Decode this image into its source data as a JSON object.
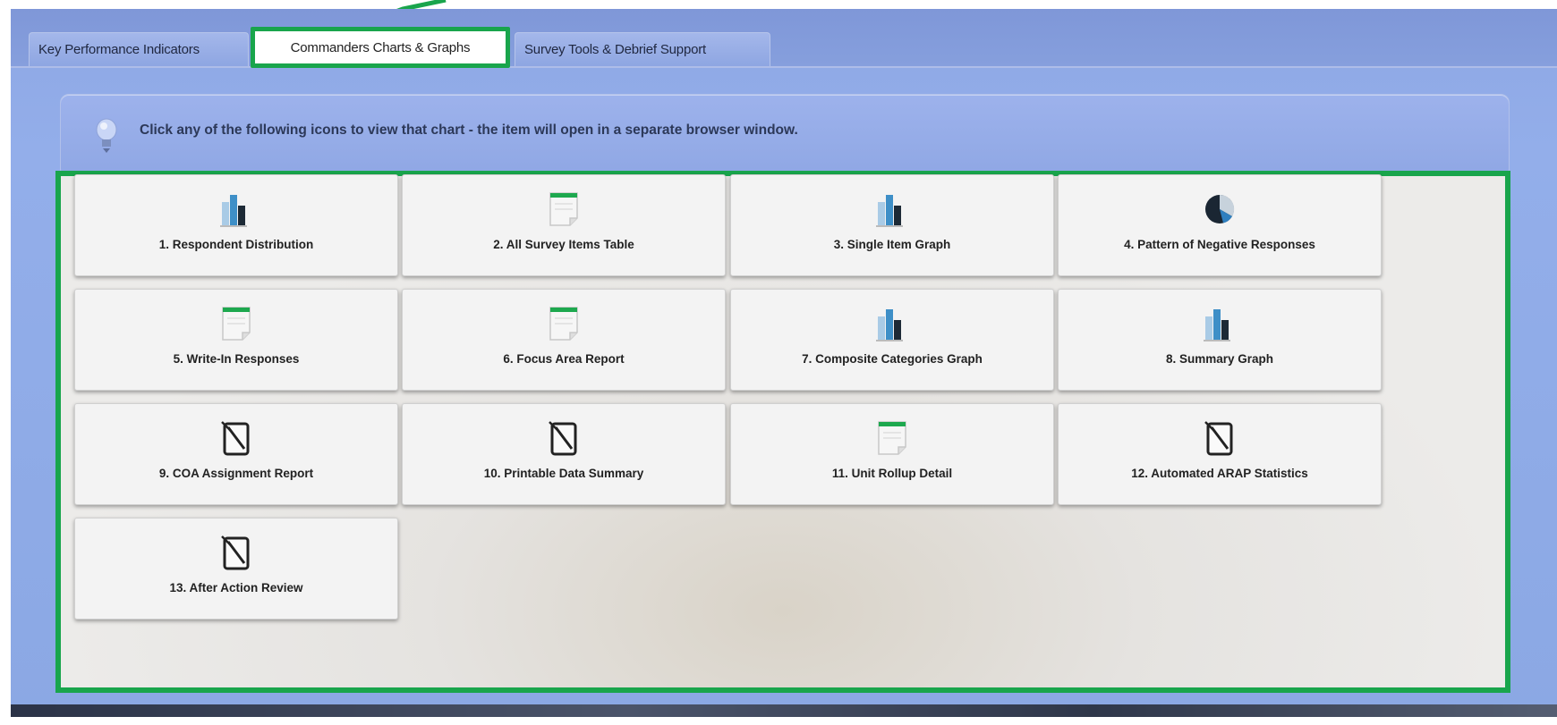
{
  "tabs": [
    {
      "label": "Key Performance Indicators"
    },
    {
      "label": "Commanders Charts & Graphs"
    },
    {
      "label": "Survey Tools & Debrief Support"
    }
  ],
  "info": {
    "message": "Click any of the following icons to view that chart - the item will open in a separate browser window.",
    "icon": "lightbulb-icon"
  },
  "cards": [
    {
      "label": "1. Respondent Distribution",
      "icon": "bar-chart-icon"
    },
    {
      "label": "2. All Survey Items Table",
      "icon": "document-icon"
    },
    {
      "label": "3. Single Item Graph",
      "icon": "bar-chart-icon"
    },
    {
      "label": "4. Pattern of Negative Responses",
      "icon": "pie-chart-icon"
    },
    {
      "label": "5. Write-In Responses",
      "icon": "document-icon"
    },
    {
      "label": "6. Focus Area Report",
      "icon": "document-icon"
    },
    {
      "label": "7. Composite Categories Graph",
      "icon": "bar-chart-icon"
    },
    {
      "label": "8. Summary Graph",
      "icon": "bar-chart-icon"
    },
    {
      "label": "9. COA Assignment Report",
      "icon": "edit-document-icon"
    },
    {
      "label": "10. Printable Data Summary",
      "icon": "edit-document-icon"
    },
    {
      "label": "11. Unit Rollup Detail",
      "icon": "document-icon"
    },
    {
      "label": "12. Automated ARAP Statistics",
      "icon": "edit-document-icon"
    },
    {
      "label": "13. After Action Review",
      "icon": "edit-document-icon"
    }
  ],
  "colors": {
    "highlight": "#19a54c",
    "background": "#8ea7e4"
  }
}
